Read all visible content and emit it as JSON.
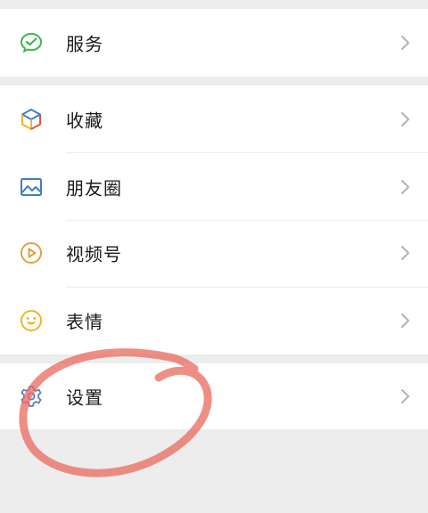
{
  "menu": {
    "items": [
      {
        "label": "服务",
        "icon": "wechat-pay-icon"
      },
      {
        "label": "收藏",
        "icon": "cube-icon"
      },
      {
        "label": "朋友圈",
        "icon": "image-icon"
      },
      {
        "label": "视频号",
        "icon": "play-circle-icon"
      },
      {
        "label": "表情",
        "icon": "smiley-icon"
      },
      {
        "label": "设置",
        "icon": "gear-icon"
      }
    ]
  },
  "colors": {
    "background": "#ededed",
    "card": "#ffffff",
    "service_green": "#3fb64f",
    "moments_blue": "#3e7ec8",
    "channels_orange": "#e0a040",
    "sticker_yellow": "#f0b429",
    "settings_blue": "#5b7fb3",
    "annotation_red": "#e86a5e"
  }
}
